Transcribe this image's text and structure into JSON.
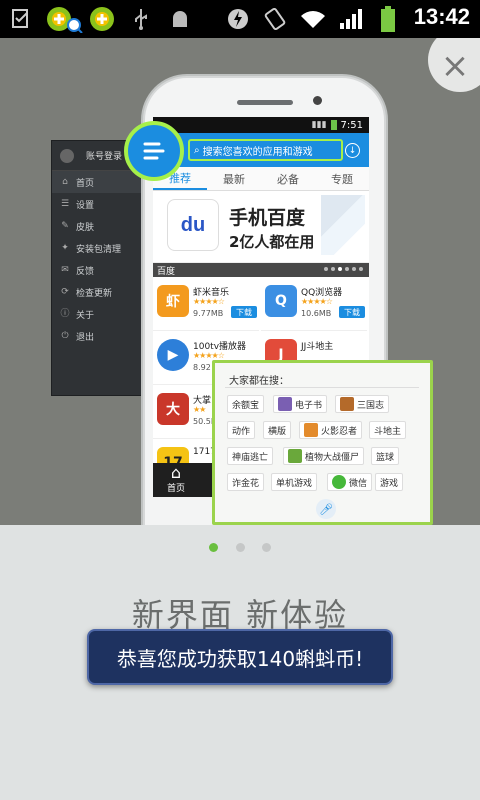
{
  "status_bar": {
    "time": "13:42",
    "icons": [
      "task-icon",
      "app360-icon",
      "app360-search-icon",
      "app360-icon",
      "usb-icon",
      "android-debug-icon",
      "flash-icon",
      "rotate-icon",
      "wifi-icon",
      "signal-icon",
      "battery-icon"
    ]
  },
  "close_symbol": "×",
  "preview": {
    "side_menu": {
      "header": "账号登录",
      "items": [
        {
          "label": "首页",
          "icon": "home-icon"
        },
        {
          "label": "设置",
          "icon": "settings-icon"
        },
        {
          "label": "皮肤",
          "icon": "skin-icon"
        },
        {
          "label": "安装包清理",
          "icon": "clean-icon"
        },
        {
          "label": "反馈",
          "icon": "feedback-icon"
        },
        {
          "label": "检查更新",
          "icon": "update-icon"
        },
        {
          "label": "关于",
          "icon": "about-icon"
        },
        {
          "label": "退出",
          "icon": "exit-icon"
        }
      ]
    },
    "phone": {
      "time": "7:51",
      "search_placeholder": "搜索您喜欢的应用和游戏",
      "tabs": [
        "推荐",
        "最新",
        "必备",
        "专题"
      ],
      "banner": {
        "logo_text": "du",
        "title": "手机百度",
        "subtitle": "2亿人都在用",
        "caption": "百度"
      },
      "apps": [
        {
          "name": "虾米音乐",
          "stars": "★★★★☆",
          "size": "9.77MB",
          "download": "下载",
          "color": "#f39a1e",
          "glyph": "虾"
        },
        {
          "name": "QQ浏览器",
          "stars": "★★★★☆",
          "size": "10.6MB",
          "download": "下载",
          "color": "#3b8fe3",
          "glyph": "Q"
        },
        {
          "name": "100tv播放器",
          "stars": "★★★★☆",
          "size": "8.92",
          "download": "",
          "color": "#2d7fd9",
          "glyph": "▶"
        },
        {
          "name": "JJ斗地主",
          "stars": "★★★★☆",
          "size": "",
          "download": "",
          "color": "#e24b3a",
          "glyph": "J"
        },
        {
          "name": "大掌",
          "stars": "★★",
          "size": "50.5M",
          "download": "",
          "color": "#c9372a",
          "glyph": "大"
        },
        {
          "name": "1717",
          "stars": "",
          "size": "",
          "download": "",
          "color": "#f5c314",
          "glyph": "17"
        }
      ],
      "bottom_home": "首页"
    },
    "popup": {
      "title": "大家都在搜：",
      "chips": [
        {
          "label": "余额宝",
          "icon": ""
        },
        {
          "label": "电子书",
          "icon": "book-icon"
        },
        {
          "label": "三国志",
          "icon": "game-icon"
        },
        {
          "label": "动作",
          "icon": ""
        },
        {
          "label": "横版",
          "icon": ""
        },
        {
          "label": "火影忍者",
          "icon": "naruto-icon"
        },
        {
          "label": "斗地主",
          "icon": ""
        },
        {
          "label": "神庙逃亡",
          "icon": ""
        },
        {
          "label": "植物大战僵尸",
          "icon": "plant-icon"
        },
        {
          "label": "篮球",
          "icon": ""
        },
        {
          "label": "诈金花",
          "icon": ""
        },
        {
          "label": "单机游戏",
          "icon": ""
        },
        {
          "label": "微信",
          "icon": "wechat-icon"
        },
        {
          "label": "游戏",
          "icon": ""
        }
      ]
    }
  },
  "pager": {
    "count": 3,
    "active": 0
  },
  "headline": "新界面 新体验",
  "toast": "恭喜您成功获取140蝌蚪币!",
  "colors": {
    "accent_blue": "#1b8de0",
    "accent_green": "#9bd34c",
    "toast_bg": "#1e3260"
  }
}
